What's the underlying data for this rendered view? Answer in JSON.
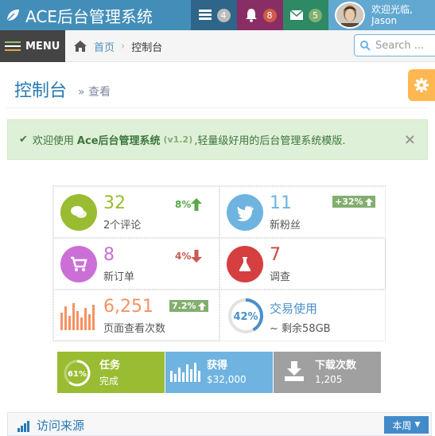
{
  "navbar": {
    "brand": "ACE后台管理系统",
    "tasks_count": "4",
    "notifications_count": "8",
    "messages_count": "5",
    "user_welcome": "欢迎光临,",
    "user_name": "Jason"
  },
  "breadcrumb": {
    "menu_label": "MENU",
    "home": "首页",
    "current": "控制台"
  },
  "search": {
    "placeholder": "Search ..."
  },
  "page_header": {
    "title": "控制台",
    "subtitle": "查看"
  },
  "alert": {
    "prefix": "欢迎使用",
    "app": "Ace后台管理系统",
    "version": "(v1.2)",
    "text": ",轻量级好用的后台管理系统模版.",
    "close": "×"
  },
  "infoboxes": [
    {
      "number": "32",
      "label": "2个评论",
      "stat": "8%",
      "trend": "up",
      "color": "#9abc32"
    },
    {
      "number": "11",
      "label": "新粉丝",
      "stat": "+32%",
      "trend": "up",
      "color": "#6fb3e0"
    },
    {
      "number": "8",
      "label": "新订单",
      "stat": "4%",
      "trend": "down",
      "color": "#cb6fd7"
    },
    {
      "number": "7",
      "label": "调查",
      "color": "#d53f40"
    },
    {
      "number": "6,251",
      "label": "页面查看次数",
      "stat": "7.2%",
      "trend": "up",
      "color": "#f79263"
    },
    {
      "number": "交易使用",
      "label": "~ 剩余58GB",
      "percent": "42%",
      "color": "#4a8fc9"
    }
  ],
  "tiles": [
    {
      "title": "任务",
      "value": "完成",
      "percent": "61%",
      "color": "#9abc32"
    },
    {
      "title": "获得",
      "value": "$32,000",
      "color": "#6fb3e0"
    },
    {
      "title": "下载次数",
      "value": "1,205",
      "color": "#a0a0a0"
    }
  ],
  "widget": {
    "title": "访问来源",
    "dropdown": "本周"
  }
}
